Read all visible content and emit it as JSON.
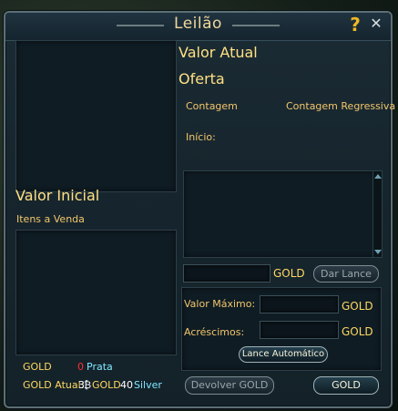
{
  "window": {
    "title": "Leilão",
    "help_label": "?",
    "close_label": "✕"
  },
  "left": {
    "initial_value_label": "Valor Inicial",
    "items_for_sale_label": "Itens a Venda",
    "gold_label": "GOLD",
    "silver_amount": "0",
    "silver_label": "Prata",
    "current_gold_label": "GOLD Atual:",
    "current_gold_amount": "3",
    "current_gold_gold_label": "GOLD",
    "current_silver_amount": "40",
    "current_silver_label": "Silver"
  },
  "right": {
    "current_value_label": "Valor Atual",
    "bid_label": "Oferta",
    "count_label": "Contagem",
    "countdown_label": "Contagem Regressiva",
    "start_label": "Início:",
    "bid_gold_unit": "GOLD",
    "bid_button": "Dar Lance",
    "max_value_label": "Valor Máximo:",
    "max_value_unit": "GOLD",
    "increment_label": "Acréscimos:",
    "increment_unit": "GOLD",
    "auto_bid_button": "Lance Automático",
    "return_gold_button": "Devolver GOLD",
    "gold_button": "GOLD"
  },
  "colors": {
    "accent_gold": "#ffd860",
    "silver_red": "#ff3030",
    "silver_cyan": "#7ee8ff"
  }
}
